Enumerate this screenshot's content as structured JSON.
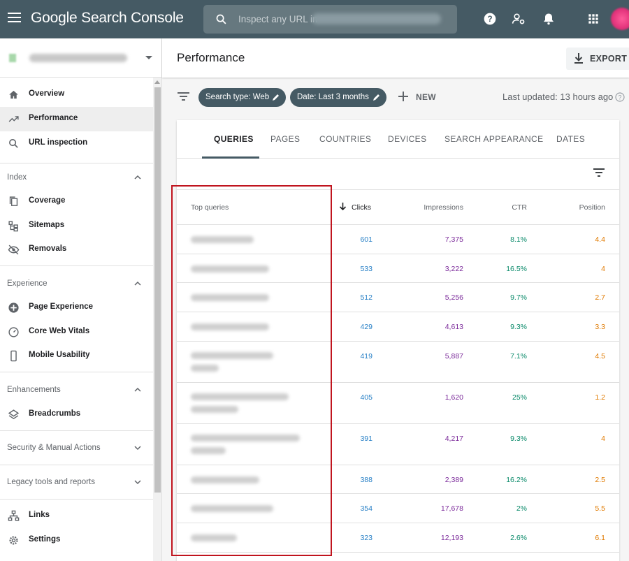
{
  "app": {
    "title": "Google Search Console",
    "search_placeholder": "Inspect any URL in"
  },
  "sidebar": {
    "items": [
      {
        "label": "Overview",
        "icon": "home-icon"
      },
      {
        "label": "Performance",
        "icon": "trending-up-icon"
      },
      {
        "label": "URL inspection",
        "icon": "search-icon"
      }
    ],
    "sections": [
      {
        "title": "Index",
        "items": [
          {
            "label": "Coverage",
            "icon": "copy-icon"
          },
          {
            "label": "Sitemaps",
            "icon": "sitemap-icon"
          },
          {
            "label": "Removals",
            "icon": "eye-off-icon"
          }
        ]
      },
      {
        "title": "Experience",
        "items": [
          {
            "label": "Page Experience",
            "icon": "plus-circle-icon"
          },
          {
            "label": "Core Web Vitals",
            "icon": "gauge-icon"
          },
          {
            "label": "Mobile Usability",
            "icon": "phone-icon"
          }
        ]
      },
      {
        "title": "Enhancements",
        "items": [
          {
            "label": "Breadcrumbs",
            "icon": "layers-icon"
          }
        ]
      },
      {
        "title": "Security & Manual Actions"
      },
      {
        "title": "Legacy tools and reports"
      }
    ],
    "bottom_items": [
      {
        "label": "Links",
        "icon": "links-icon"
      },
      {
        "label": "Settings",
        "icon": "gear-icon"
      }
    ]
  },
  "main": {
    "page_title": "Performance",
    "export_label": "EXPORT",
    "filters": {
      "chips": [
        "Search type: Web",
        "Date: Last 3 months"
      ],
      "new_label": "NEW",
      "last_updated": "Last updated: 13 hours ago"
    },
    "tabs": [
      "QUERIES",
      "PAGES",
      "COUNTRIES",
      "DEVICES",
      "SEARCH APPEARANCE",
      "DATES"
    ],
    "table": {
      "columns": [
        "Top queries",
        "Clicks",
        "Impressions",
        "CTR",
        "Position"
      ],
      "rows": [
        {
          "clicks": "601",
          "impressions": "7,375",
          "ctr": "8.1%",
          "position": "4.4"
        },
        {
          "clicks": "533",
          "impressions": "3,222",
          "ctr": "16.5%",
          "position": "4"
        },
        {
          "clicks": "512",
          "impressions": "5,256",
          "ctr": "9.7%",
          "position": "2.7"
        },
        {
          "clicks": "429",
          "impressions": "4,613",
          "ctr": "9.3%",
          "position": "3.3"
        },
        {
          "clicks": "419",
          "impressions": "5,887",
          "ctr": "7.1%",
          "position": "4.5"
        },
        {
          "clicks": "405",
          "impressions": "1,620",
          "ctr": "25%",
          "position": "1.2"
        },
        {
          "clicks": "391",
          "impressions": "4,217",
          "ctr": "9.3%",
          "position": "4"
        },
        {
          "clicks": "388",
          "impressions": "2,389",
          "ctr": "16.2%",
          "position": "2.5"
        },
        {
          "clicks": "354",
          "impressions": "17,678",
          "ctr": "2%",
          "position": "5.5"
        },
        {
          "clicks": "323",
          "impressions": "12,193",
          "ctr": "2.6%",
          "position": "6.1"
        }
      ]
    }
  },
  "colors": {
    "header_bg": "#455a64",
    "clicks": "#2880c6",
    "impressions": "#7b2a9a",
    "ctr": "#0a8a6a",
    "position": "#e07a00",
    "highlight_border": "#c0141e"
  }
}
